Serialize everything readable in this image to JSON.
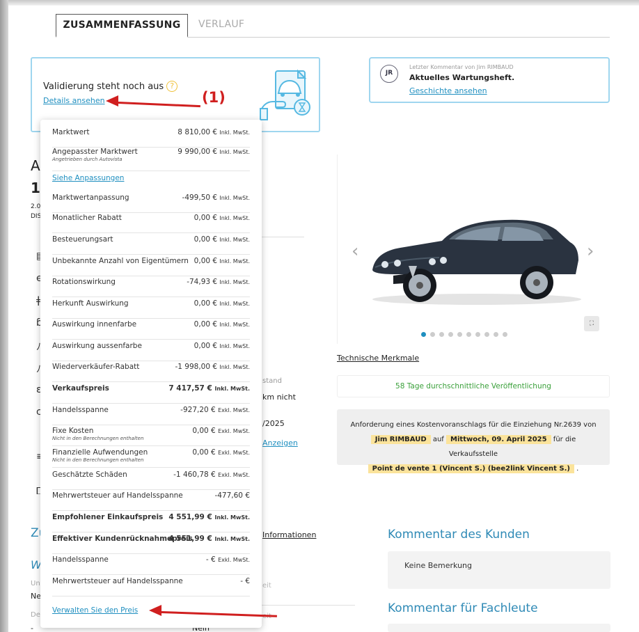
{
  "tabs": {
    "summary": "ZUSAMMENFASSUNG",
    "history": "VERLAUF"
  },
  "validation": {
    "title": "Validierung steht noch aus",
    "details_link": "Details ansehen"
  },
  "comment": {
    "initials": "JR",
    "meta": "Letzter Kommentar von Jim RIMBAUD",
    "text": "Aktuelles Wartungsheft.",
    "history_link": "Geschichte ansehen"
  },
  "annotation": {
    "label": "(1)"
  },
  "background": {
    "a": "A",
    "one": "1",
    "spec1": "2.0",
    "spec2": "DIS",
    "stand": "stand",
    "km": "km nicht",
    "date": "/2025",
    "anzeigen": "Anzeigen",
    "informationen": "Informationen",
    "zu": "Zu",
    "w": "W",
    "un": "Un",
    "ne": "Ne",
    "de": "De",
    "eit1": "eit",
    "eit2": "eit",
    "dash": "-",
    "nein": "Nein"
  },
  "gallery": {
    "dots": 10,
    "active_dot": 0
  },
  "tech_link": "Technische Merkmale",
  "publication": "58 Tage durchschnittliche Veröffentlichung",
  "quote_request": {
    "line1": "Anforderung eines Kostenvoranschlags für die Einziehung Nr.2639 von",
    "user": "Jim RIMBAUD",
    "on": "auf",
    "date": "Mittwoch, 09. April 2025",
    "for": "für die Verkaufsstelle",
    "store": "Point de vente 1 (Vincent S.) (bee2link Vincent S.)",
    "dot": "."
  },
  "customer_comment": {
    "title": "Kommentar des Kunden",
    "text": "Keine Bemerkung"
  },
  "pro_comment": {
    "title": "Kommentar für Fachleute"
  },
  "price_popup": {
    "rows": [
      {
        "label": "Marktwert",
        "value": "8 810,00 €",
        "unit": "Inkl. MwSt.",
        "bold": false
      },
      {
        "label": "Angepasster Marktwert",
        "sub": "Angetrieben durch Autovista",
        "value": "9 990,00 €",
        "unit": "Inkl. MwSt.",
        "bold": false
      },
      {
        "label": "Marktwertanpassung",
        "value": "-499,50 €",
        "unit": "Inkl. MwSt.",
        "bold": false
      },
      {
        "label": "Monatlicher Rabatt",
        "value": "0,00 €",
        "unit": "Inkl. MwSt.",
        "bold": false
      },
      {
        "label": "Besteuerungsart",
        "value": "0,00 €",
        "unit": "Inkl. MwSt.",
        "bold": false
      },
      {
        "label": "Unbekannte Anzahl von Eigentümern",
        "value": "0,00 €",
        "unit": "Inkl. MwSt.",
        "bold": false
      },
      {
        "label": "Rotationswirkung",
        "value": "-74,93 €",
        "unit": "Inkl. MwSt.",
        "bold": false
      },
      {
        "label": "Herkunft Auswirkung",
        "value": "0,00 €",
        "unit": "Inkl. MwSt.",
        "bold": false
      },
      {
        "label": "Auswirkung innenfarbe",
        "value": "0,00 €",
        "unit": "Inkl. MwSt.",
        "bold": false
      },
      {
        "label": "Auswirkung aussenfarbe",
        "value": "0,00 €",
        "unit": "Inkl. MwSt.",
        "bold": false
      },
      {
        "label": "Wiederverkäufer-Rabatt",
        "value": "-1 998,00 €",
        "unit": "Inkl. MwSt.",
        "bold": false
      },
      {
        "label": "Verkaufspreis",
        "value": "7 417,57 €",
        "unit": "Inkl. MwSt.",
        "bold": true
      },
      {
        "label": "Handelsspanne",
        "value": "-927,20 €",
        "unit": "Exkl. MwSt.",
        "bold": false
      },
      {
        "label": "Fixe Kosten",
        "sub": "Nicht in den Berechnungen enthalten",
        "value": "0,00 €",
        "unit": "Exkl. MwSt.",
        "bold": false
      },
      {
        "label": "Finanzielle Aufwendungen",
        "sub": "Nicht in den Berechnungen enthalten",
        "value": "0,00 €",
        "unit": "Exkl. MwSt.",
        "bold": false
      },
      {
        "label": "Geschätzte Schäden",
        "value": "-1 460,78 €",
        "unit": "Exkl. MwSt.",
        "bold": false
      },
      {
        "label": "Mehrwertsteuer auf Handelsspanne",
        "value": "-477,60 €",
        "unit": "",
        "bold": false
      },
      {
        "label": "Empfohlener Einkaufspreis",
        "value": "4 551,99 €",
        "unit": "Inkl. MwSt.",
        "bold": true
      },
      {
        "label": "Effektiver Kundenrücknahmepreis",
        "value": "4 551,99 €",
        "unit": "Inkl. MwSt.",
        "bold": true
      },
      {
        "label": "Handelsspanne",
        "value": "- €",
        "unit": "Exkl. MwSt.",
        "bold": false
      },
      {
        "label": "Mehrwertsteuer auf Handelsspanne",
        "value": "- €",
        "unit": "",
        "bold": false
      }
    ],
    "adjustments_link": "Siehe Anpassungen",
    "manage_link": "Verwalten Sie den Preis"
  }
}
